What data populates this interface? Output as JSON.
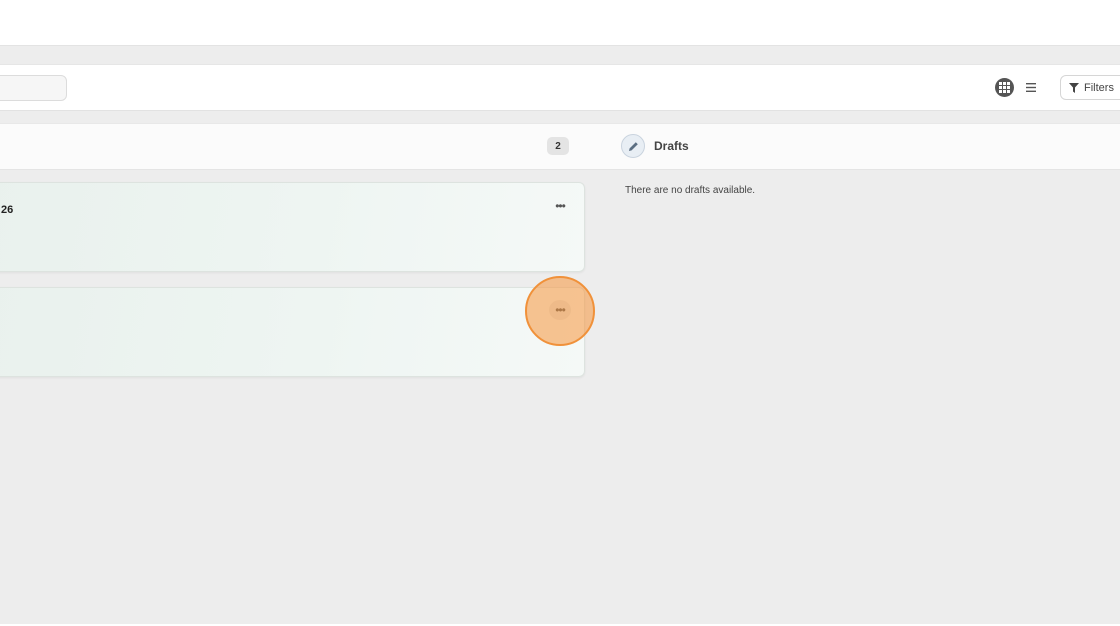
{
  "toolbar": {
    "grid_view_icon": "grid-icon",
    "list_view_icon": "list-icon",
    "filters_label": "Filters",
    "filters_icon": "funnel-icon"
  },
  "column_published": {
    "count": "2"
  },
  "column_drafts": {
    "title": "Drafts",
    "icon": "pencil-icon",
    "empty_message": "There are no drafts available."
  },
  "cards": [
    {
      "title": "26",
      "menu_label": "•••"
    },
    {
      "title": "",
      "menu_label": "•••"
    }
  ],
  "colors": {
    "background": "#ededed",
    "card_tint": "#eef5f2",
    "click_marker": "#f0913a"
  }
}
